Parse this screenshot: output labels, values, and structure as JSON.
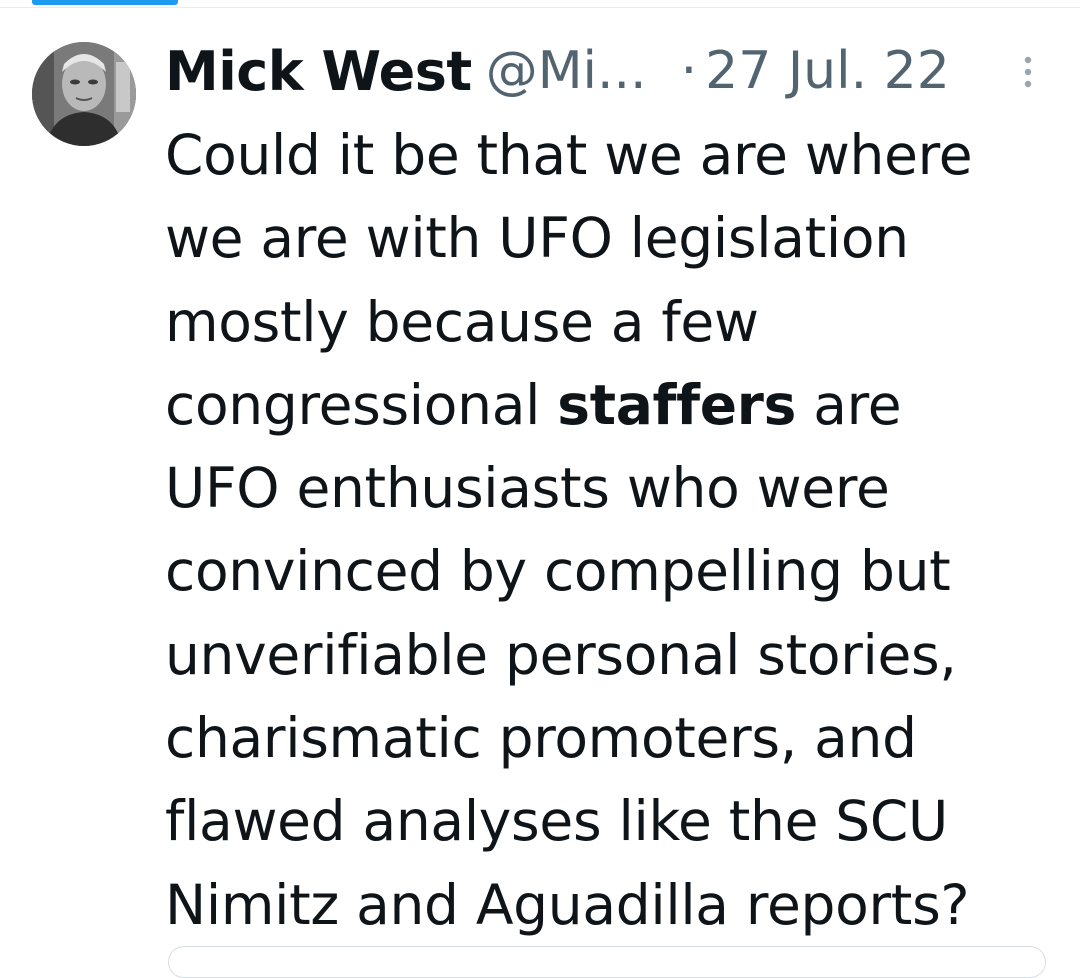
{
  "tweet": {
    "author_name": "Mick West",
    "author_handle": "@Mi...",
    "separator": "·",
    "date": "27 Jul. 22",
    "avatar_icon": "person-photo-avatar",
    "more_icon": "vertical-ellipsis-icon",
    "lines": [
      "Could it be that we are where",
      "we are with UFO legislation",
      "mostly because a few",
      {
        "before": "congressional ",
        "bold": "staffers",
        "after": " are"
      },
      "UFO enthusiasts who were",
      "convinced by compelling but",
      "unverifiable personal stories,",
      "charismatic promoters, and",
      "flawed analyses like the SCU",
      "Nimitz and Aguadilla reports?"
    ]
  },
  "colors": {
    "text": "#0f1419",
    "secondary": "#536471",
    "accent": "#1d9bf0"
  }
}
